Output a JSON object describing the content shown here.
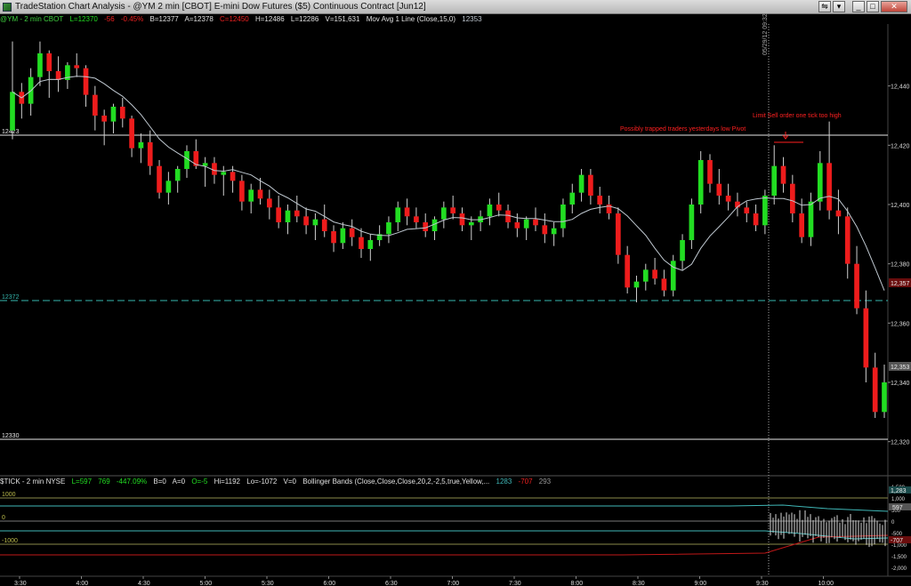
{
  "window": {
    "title": "TradeStation Chart Analysis - @YM 2 min [CBOT] E-mini Dow Futures ($5) Continuous Contract [Jun12]",
    "buttons": [
      "⇋",
      "▾",
      "_",
      "□",
      "✕"
    ]
  },
  "price_header": {
    "symbol": "@YM - 2 min  CBOT",
    "last": "L=12370",
    "net_change": "-56",
    "pct_change": "-0.45%",
    "bid": "B=12377",
    "ask": "A=12378",
    "change2": "C=12450",
    "high": "H=12486",
    "low": "L=12286",
    "volume": "V=151,631",
    "indicator": "Mov Avg 1 Line (Close,15,0)",
    "indicator_value": "12353"
  },
  "tick_header": {
    "symbol": "$TICK - 2 min  NYSE",
    "last": "L=597",
    "net_change": "769",
    "pct_change": "-447.09%",
    "bid": "B=0",
    "ask": "A=0",
    "other": "O=-5",
    "high": "Hi=1192",
    "low": "Lo=-1072",
    "volume": "V=0",
    "indicator": "Bollinger Bands (Close,Close,Close,20,2,-2,5,true,Yellow,...",
    "bb_upper": "1283",
    "bb_lower": "-707",
    "bb_mid": "293"
  },
  "time_axis": {
    "labels": [
      "3:30",
      "4:00",
      "4:30",
      "5:00",
      "5:30",
      "6:00",
      "6:30",
      "7:00",
      "7:30",
      "8:00",
      "8:30",
      "9:00",
      "9:30",
      "10:00"
    ]
  },
  "price_axis": {
    "labels": [
      "12,440",
      "12,420",
      "12,400",
      "12,380",
      "12,360",
      "12,340",
      "12,320"
    ],
    "last_price_box": "12,357",
    "current_box": "12,353"
  },
  "tick_axis": {
    "labels": [
      "1,500",
      "1,000",
      "500",
      "0",
      "-500",
      "-1,000",
      "-1,500",
      "-2,000"
    ],
    "boxes": [
      "1,283",
      "597",
      "-707"
    ]
  },
  "levels": {
    "level_high": "12423",
    "level_mid": "12372",
    "level_low": "12330"
  },
  "tick_levels": {
    "plus1000": "1000",
    "zero": "0",
    "minus1000": "-1000"
  },
  "annotations": {
    "trapped_traders": "Possibly trapped traders  yesterdays low  Pivot",
    "limit_sell": "Limit Sell order one tick too high",
    "session_marker": "05/29/12 09:32"
  },
  "colors": {
    "up_candle": "#22dd22",
    "down_candle": "#ee1c1c",
    "ma_line": "#bfc8d0",
    "annotation": "#ff2020",
    "cyan_level": "#36b8b0",
    "tick_bars": "#d8d8d8",
    "bb_upper": "#3fb7b7",
    "bb_lower": "#c01818"
  },
  "chart_data": {
    "type": "candlestick",
    "interval": "2 min",
    "price_range": [
      12310,
      12460
    ],
    "candles": [
      [
        12425,
        12455,
        12422,
        12438
      ],
      [
        12438,
        12441,
        12429,
        12434
      ],
      [
        12434,
        12446,
        12430,
        12443
      ],
      [
        12443,
        12455,
        12440,
        12451
      ],
      [
        12451,
        12452,
        12436,
        12445
      ],
      [
        12445,
        12450,
        12438,
        12442
      ],
      [
        12442,
        12448,
        12439,
        12447
      ],
      [
        12447,
        12451,
        12443,
        12446
      ],
      [
        12446,
        12447,
        12433,
        12437
      ],
      [
        12437,
        12440,
        12425,
        12430
      ],
      [
        12430,
        12432,
        12420,
        12428
      ],
      [
        12428,
        12434,
        12424,
        12433
      ],
      [
        12433,
        12436,
        12426,
        12429
      ],
      [
        12429,
        12430,
        12416,
        12419
      ],
      [
        12419,
        12424,
        12414,
        12421
      ],
      [
        12421,
        12425,
        12410,
        12413
      ],
      [
        12413,
        12415,
        12402,
        12404
      ],
      [
        12404,
        12411,
        12400,
        12408
      ],
      [
        12408,
        12413,
        12404,
        12412
      ],
      [
        12412,
        12420,
        12409,
        12418
      ],
      [
        12418,
        12422,
        12412,
        12413
      ],
      [
        12413,
        12416,
        12406,
        12414
      ],
      [
        12414,
        12416,
        12407,
        12410
      ],
      [
        12410,
        12413,
        12403,
        12411
      ],
      [
        12411,
        12413,
        12404,
        12408
      ],
      [
        12408,
        12410,
        12398,
        12401
      ],
      [
        12401,
        12407,
        12397,
        12405
      ],
      [
        12405,
        12409,
        12400,
        12402
      ],
      [
        12402,
        12405,
        12395,
        12399
      ],
      [
        12399,
        12403,
        12392,
        12394
      ],
      [
        12394,
        12400,
        12390,
        12398
      ],
      [
        12398,
        12403,
        12394,
        12396
      ],
      [
        12396,
        12399,
        12390,
        12393
      ],
      [
        12393,
        12397,
        12388,
        12395
      ],
      [
        12395,
        12400,
        12389,
        12391
      ],
      [
        12391,
        12393,
        12384,
        12387
      ],
      [
        12387,
        12394,
        12385,
        12392
      ],
      [
        12392,
        12395,
        12386,
        12389
      ],
      [
        12389,
        12392,
        12382,
        12385
      ],
      [
        12385,
        12390,
        12381,
        12388
      ],
      [
        12388,
        12393,
        12386,
        12390
      ],
      [
        12390,
        12396,
        12387,
        12394
      ],
      [
        12394,
        12401,
        12391,
        12399
      ],
      [
        12399,
        12402,
        12393,
        12396
      ],
      [
        12396,
        12399,
        12392,
        12394
      ],
      [
        12394,
        12397,
        12389,
        12391
      ],
      [
        12391,
        12396,
        12388,
        12395
      ],
      [
        12395,
        12401,
        12392,
        12399
      ],
      [
        12399,
        12403,
        12395,
        12397
      ],
      [
        12397,
        12399,
        12391,
        12393
      ],
      [
        12393,
        12396,
        12388,
        12394
      ],
      [
        12394,
        12398,
        12391,
        12396
      ],
      [
        12396,
        12402,
        12393,
        12400
      ],
      [
        12400,
        12404,
        12396,
        12398
      ],
      [
        12398,
        12400,
        12392,
        12394
      ],
      [
        12394,
        12397,
        12389,
        12392
      ],
      [
        12392,
        12396,
        12388,
        12395
      ],
      [
        12395,
        12399,
        12391,
        12393
      ],
      [
        12393,
        12397,
        12387,
        12390
      ],
      [
        12390,
        12394,
        12386,
        12392
      ],
      [
        12392,
        12402,
        12389,
        12400
      ],
      [
        12400,
        12407,
        12397,
        12404
      ],
      [
        12404,
        12412,
        12401,
        12410
      ],
      [
        12410,
        12412,
        12400,
        12403
      ],
      [
        12403,
        12406,
        12397,
        12400
      ],
      [
        12400,
        12403,
        12395,
        12397
      ],
      [
        12397,
        12399,
        12380,
        12383
      ],
      [
        12383,
        12386,
        12370,
        12372
      ],
      [
        12372,
        12376,
        12367,
        12374
      ],
      [
        12374,
        12380,
        12371,
        12378
      ],
      [
        12378,
        12382,
        12373,
        12375
      ],
      [
        12375,
        12378,
        12369,
        12371
      ],
      [
        12371,
        12383,
        12369,
        12381
      ],
      [
        12381,
        12390,
        12378,
        12388
      ],
      [
        12388,
        12402,
        12385,
        12400
      ],
      [
        12400,
        12418,
        12397,
        12415
      ],
      [
        12415,
        12417,
        12404,
        12407
      ],
      [
        12407,
        12412,
        12400,
        12403
      ],
      [
        12403,
        12407,
        12398,
        12401
      ],
      [
        12401,
        12404,
        12396,
        12399
      ],
      [
        12399,
        12401,
        12394,
        12397
      ],
      [
        12397,
        12400,
        12391,
        12393
      ],
      [
        12393,
        12405,
        12390,
        12403
      ],
      [
        12403,
        12420,
        12400,
        12413
      ],
      [
        12413,
        12416,
        12404,
        12407
      ],
      [
        12407,
        12410,
        12394,
        12397
      ],
      [
        12397,
        12402,
        12387,
        12389
      ],
      [
        12389,
        12404,
        12386,
        12401
      ],
      [
        12401,
        12418,
        12398,
        12414
      ],
      [
        12414,
        12428,
        12395,
        12398
      ],
      [
        12398,
        12405,
        12390,
        12396
      ],
      [
        12396,
        12399,
        12375,
        12380
      ],
      [
        12380,
        12386,
        12363,
        12365
      ],
      [
        12365,
        12371,
        12340,
        12345
      ],
      [
        12345,
        12350,
        12328,
        12330
      ],
      [
        12330,
        12346,
        12328,
        12340
      ]
    ]
  }
}
